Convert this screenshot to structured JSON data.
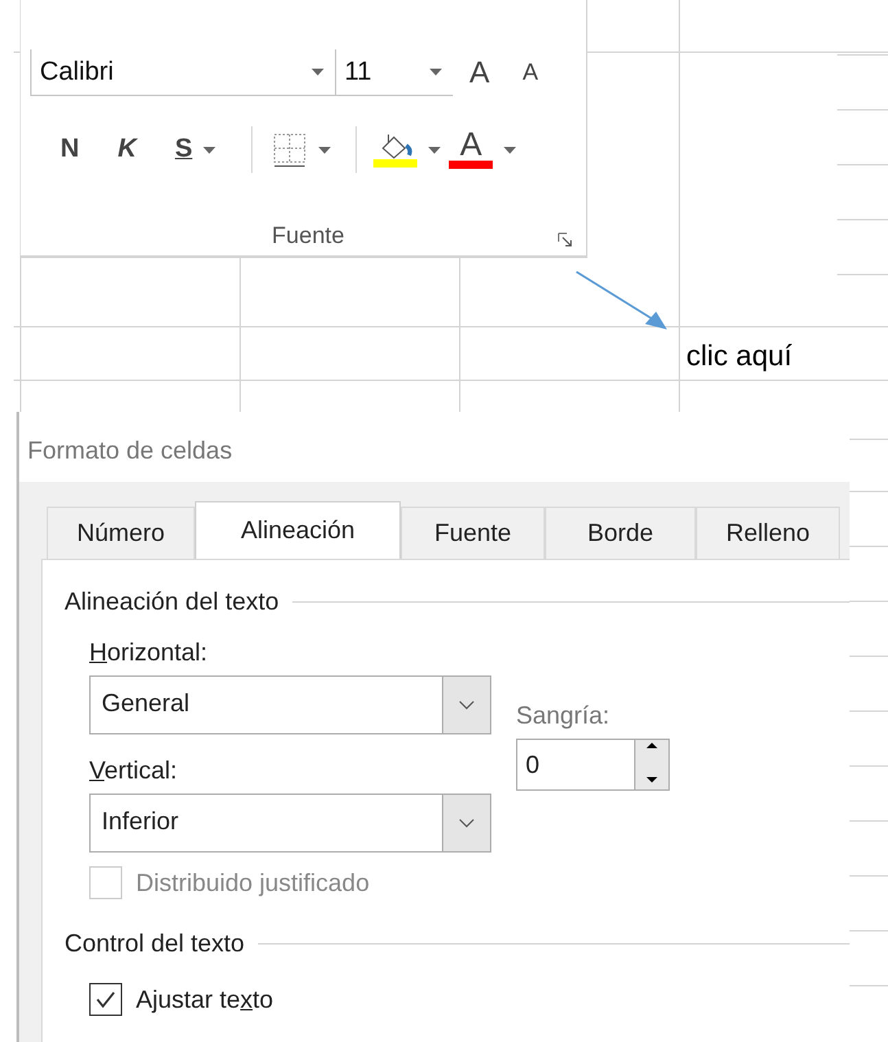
{
  "ribbon": {
    "font_name": "Calibri",
    "font_size": "11",
    "grow_font": "A",
    "shrink_font": "A",
    "buttons": [
      {
        "kind": "bold",
        "label": "N",
        "dropdown": false
      },
      {
        "kind": "italic",
        "label": "K",
        "dropdown": false
      },
      {
        "kind": "underline",
        "label": "S",
        "dropdown": true
      },
      {
        "kind": "borders",
        "dropdown": true
      },
      {
        "kind": "fill",
        "color": "#ffff00",
        "dropdown": true
      },
      {
        "kind": "font-color",
        "label": "A",
        "color": "#ff0000",
        "dropdown": true
      }
    ],
    "group_label": "Fuente"
  },
  "callout": "clic aquí",
  "dialog": {
    "title": "Formato de celdas",
    "tabs": [
      {
        "label": "Número",
        "selected": false
      },
      {
        "label": "Alineación",
        "selected": true
      },
      {
        "label": "Fuente",
        "selected": false
      },
      {
        "label": "Borde",
        "selected": false
      },
      {
        "label": "Relleno",
        "selected": false
      }
    ],
    "section_alignment": "Alineación del texto",
    "horizontal": {
      "label": {
        "key": "H",
        "after": "orizontal:"
      },
      "value": "General"
    },
    "indent": {
      "label": "Sangría:",
      "value": "0"
    },
    "vertical": {
      "label": {
        "key": "V",
        "after": "ertical:"
      },
      "value": "Inferior"
    },
    "distributed": {
      "label": {
        "before": "Distribuido justificado"
      },
      "checked": false,
      "disabled": true
    },
    "section_control": "Control del texto",
    "wrap": {
      "label": {
        "before": "Ajustar te",
        "key": "x",
        "after": "to"
      },
      "checked": true,
      "disabled": false
    }
  }
}
